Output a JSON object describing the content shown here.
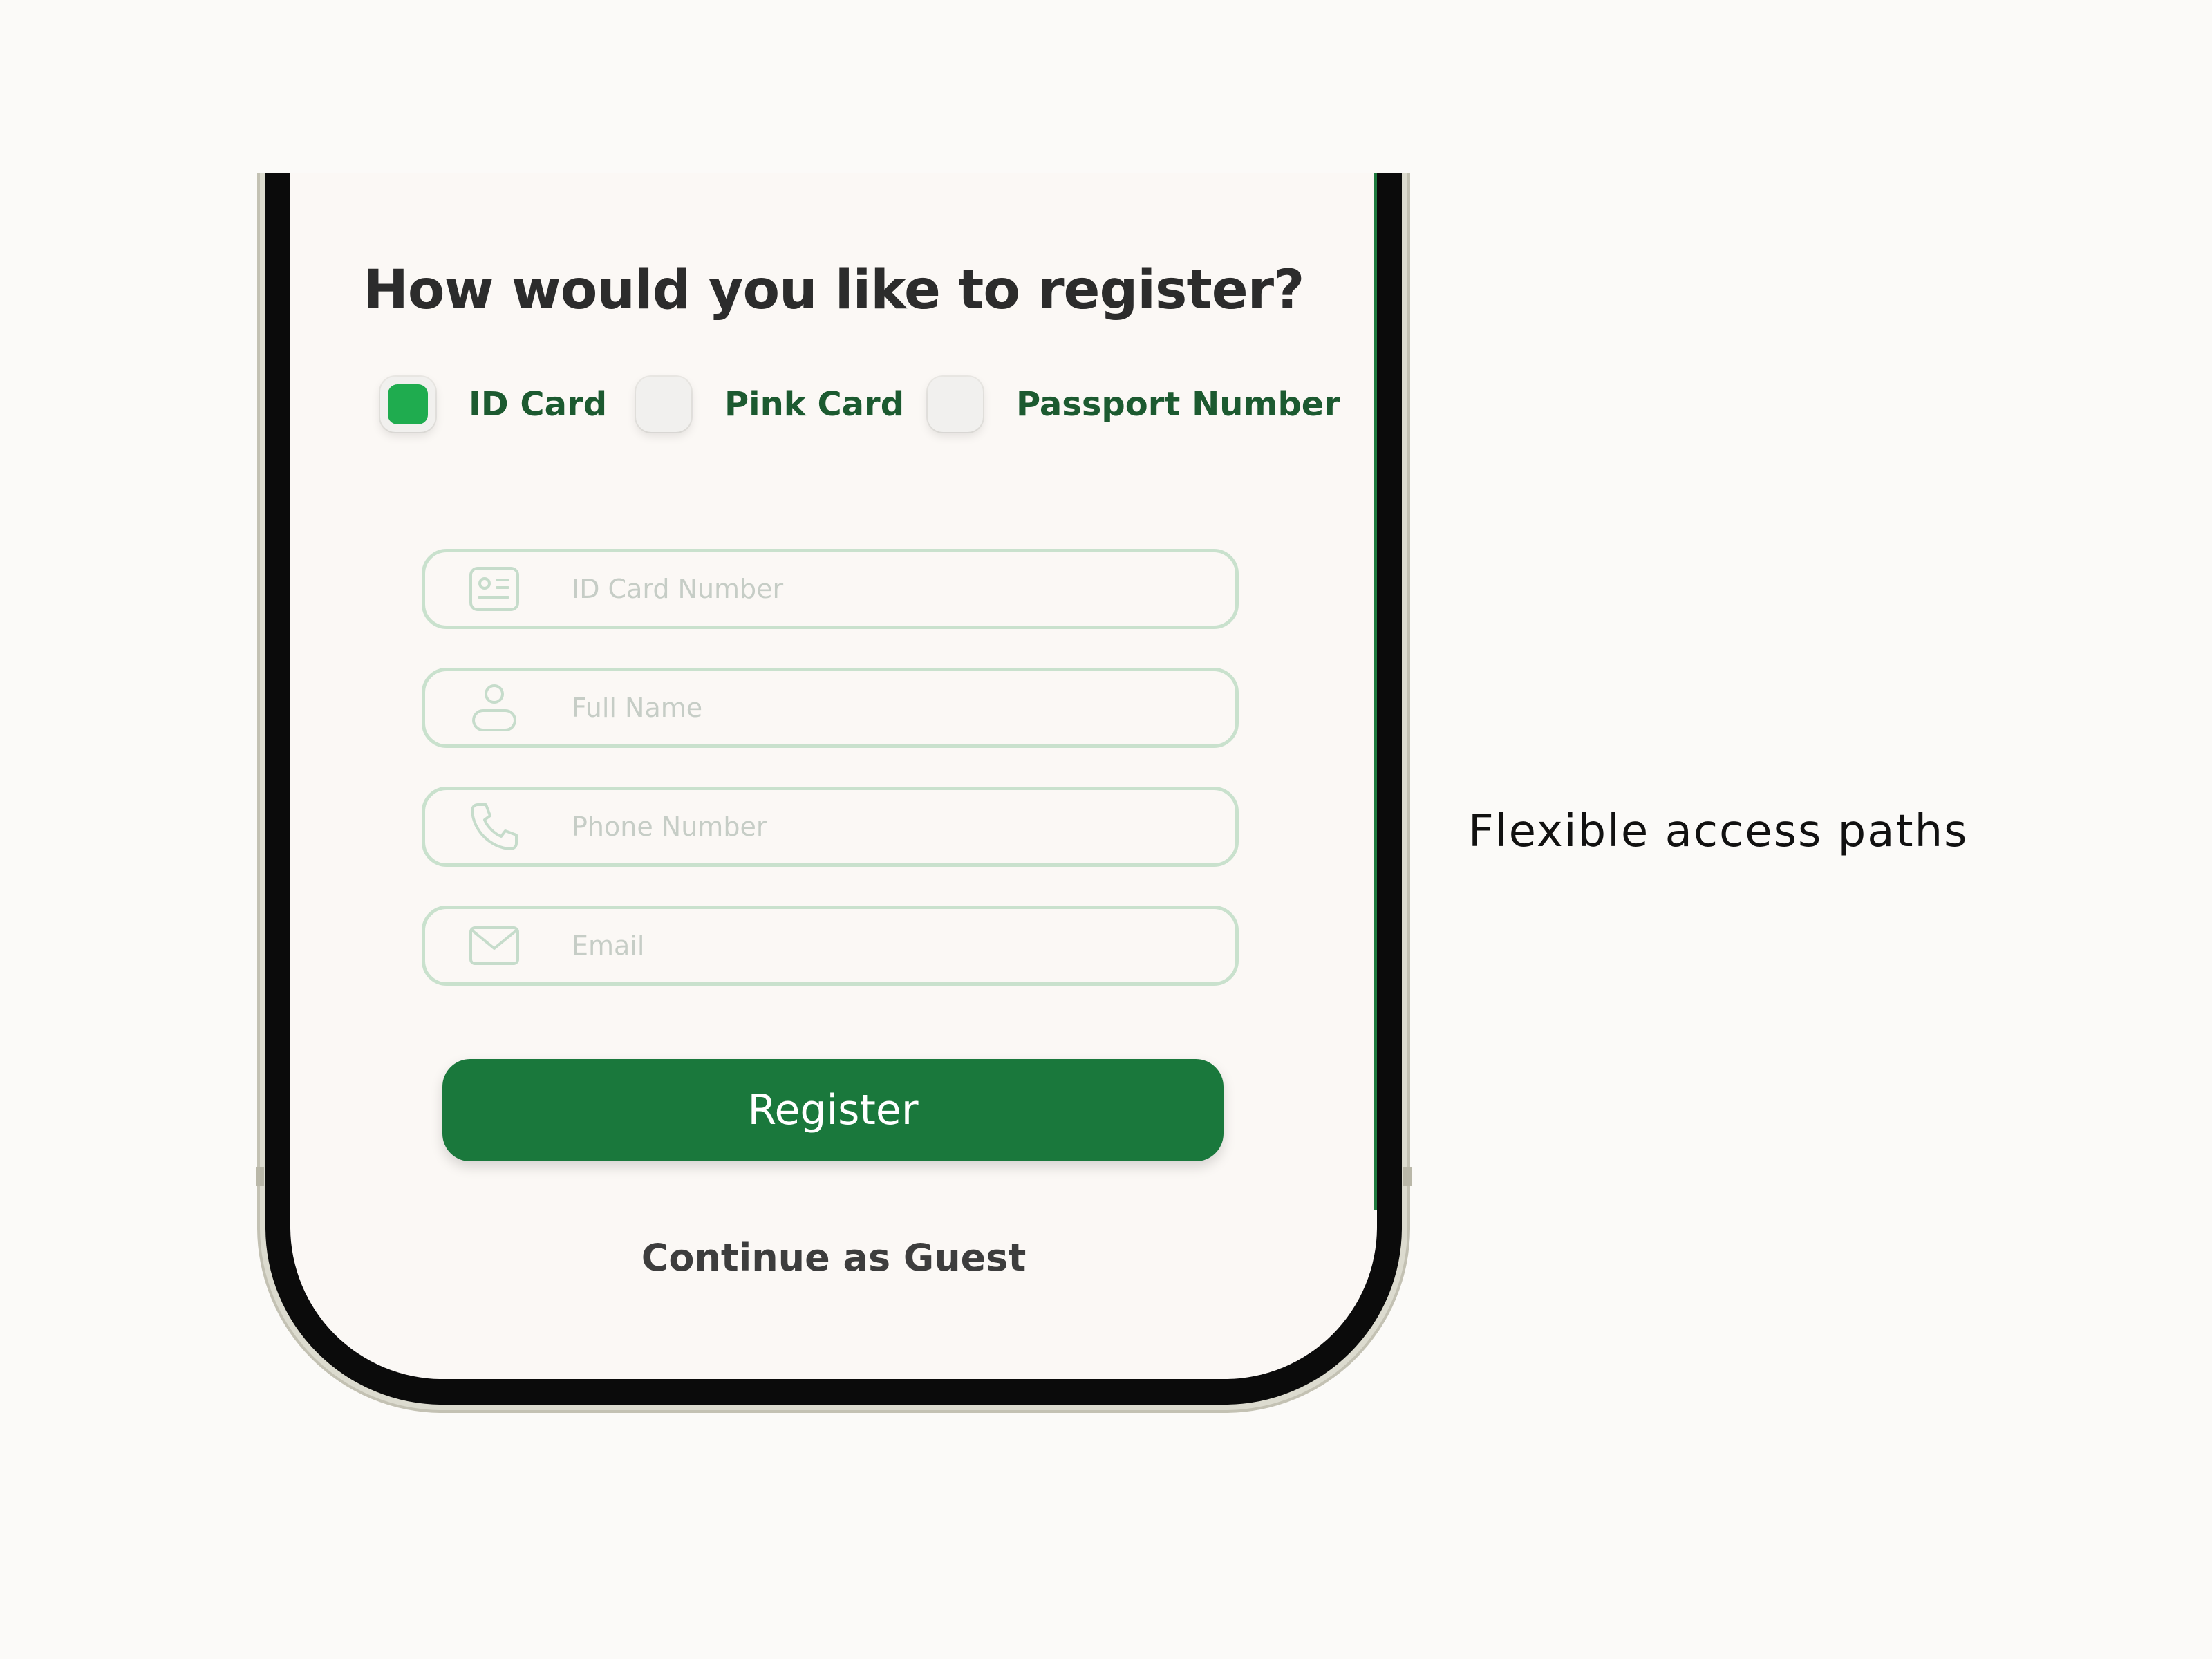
{
  "screen": {
    "title": "How would you like to register?",
    "options": [
      {
        "label": "ID Card",
        "selected": true
      },
      {
        "label": "Pink Card",
        "selected": false
      },
      {
        "label": "Passport Number",
        "selected": false
      }
    ],
    "fields": [
      {
        "placeholder": "ID Card Number",
        "icon": "id-card-icon",
        "value": ""
      },
      {
        "placeholder": "Full Name",
        "icon": "person-icon",
        "value": ""
      },
      {
        "placeholder": "Phone Number",
        "icon": "phone-icon",
        "value": ""
      },
      {
        "placeholder": "Email",
        "icon": "envelope-icon",
        "value": ""
      }
    ],
    "register_label": "Register",
    "guest_label": "Continue as Guest"
  },
  "caption": "Flexible access paths",
  "colors": {
    "background": "#fbfaf8",
    "screen": "#fbf8f5",
    "primary_green": "#1a783c",
    "selected_green": "#1fac4f",
    "label_green": "#1c5a30",
    "field_border": "#c9e1cd",
    "placeholder": "#c6cdc6"
  }
}
